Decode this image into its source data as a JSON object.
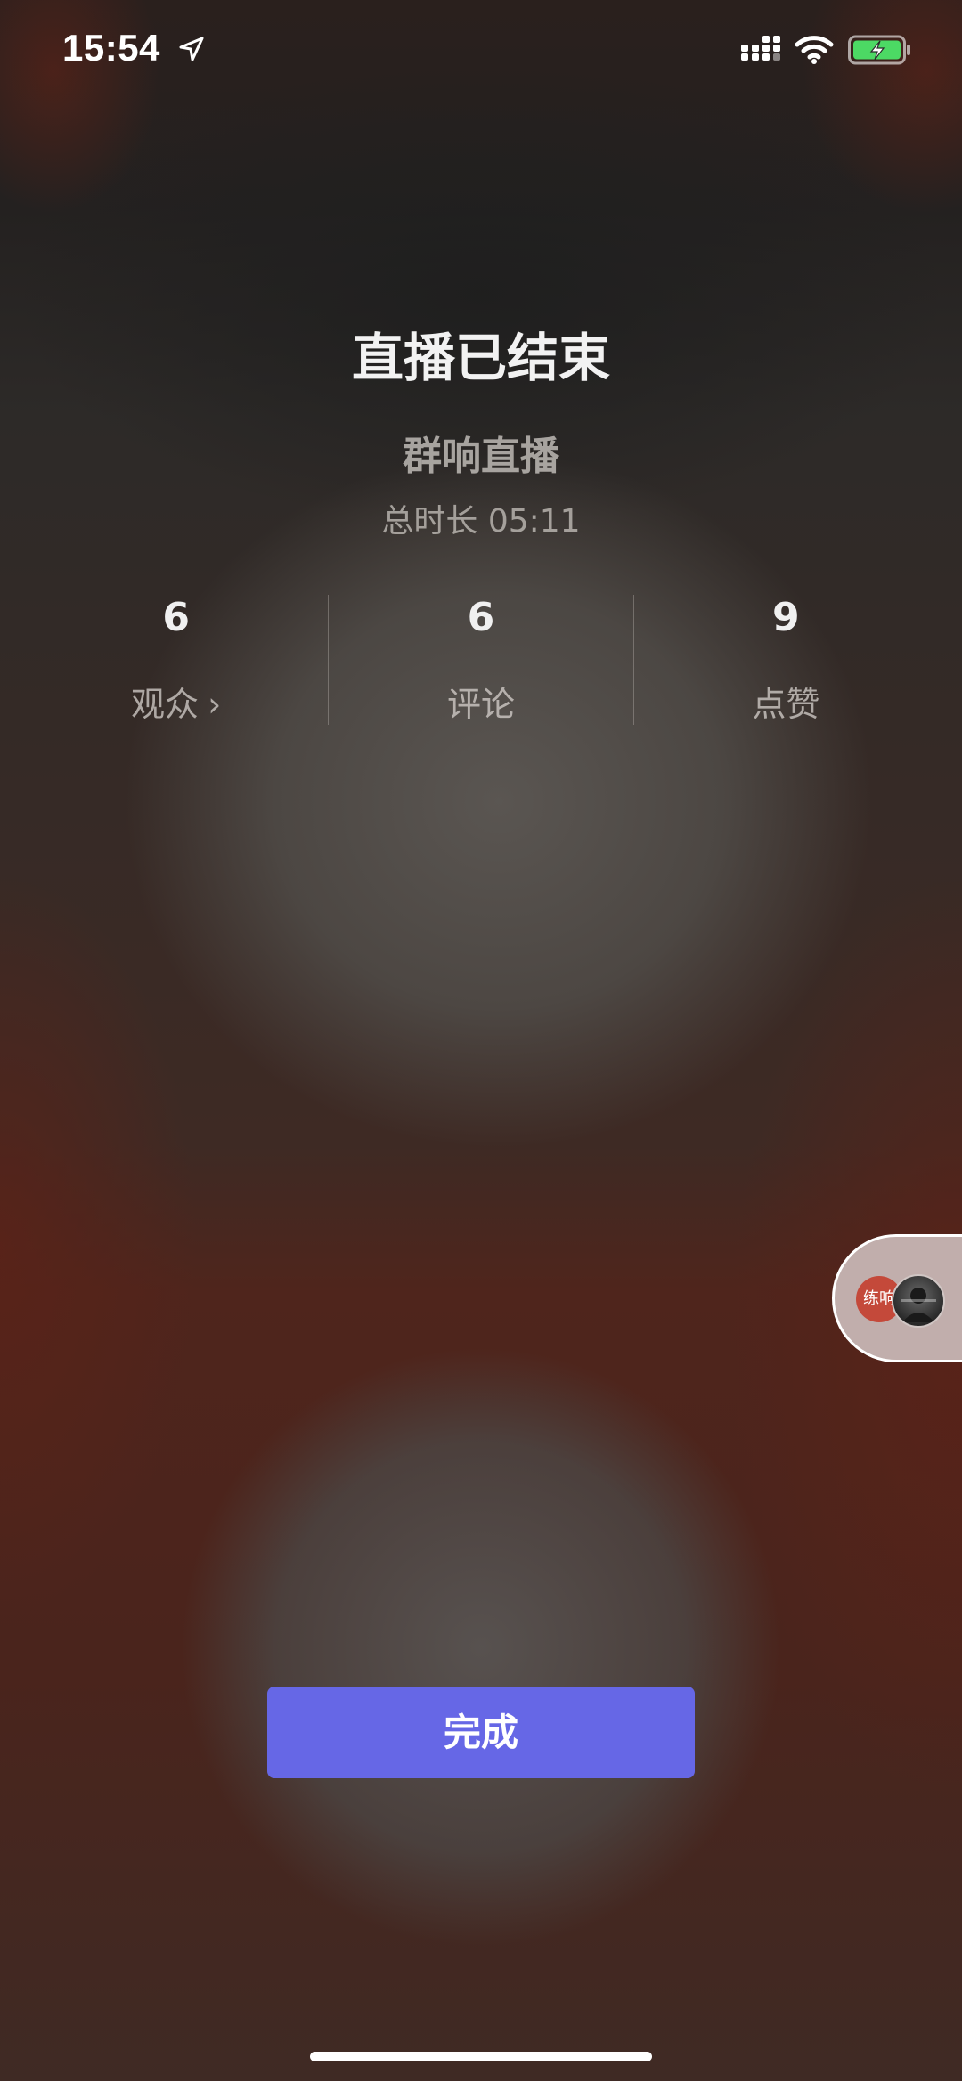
{
  "status_bar": {
    "time": "15:54",
    "icons": [
      "location-arrow-icon",
      "signal-icon",
      "wifi-icon",
      "battery-charging-icon"
    ],
    "battery_color": "#4cd964"
  },
  "live_end": {
    "title": "直播已结束",
    "subtitle": "群响直播",
    "duration": "总时长 05:11"
  },
  "stats": [
    {
      "value": "6",
      "label": "观众",
      "has_chevron": true
    },
    {
      "value": "6",
      "label": "评论"
    },
    {
      "value": "9",
      "label": "点赞"
    }
  ],
  "chevron_glyph": "›",
  "float_bubble": {
    "badge_text": "练响",
    "badge_color": "#c4493a"
  },
  "done_button": {
    "label": "完成",
    "color": "#6667e6"
  }
}
